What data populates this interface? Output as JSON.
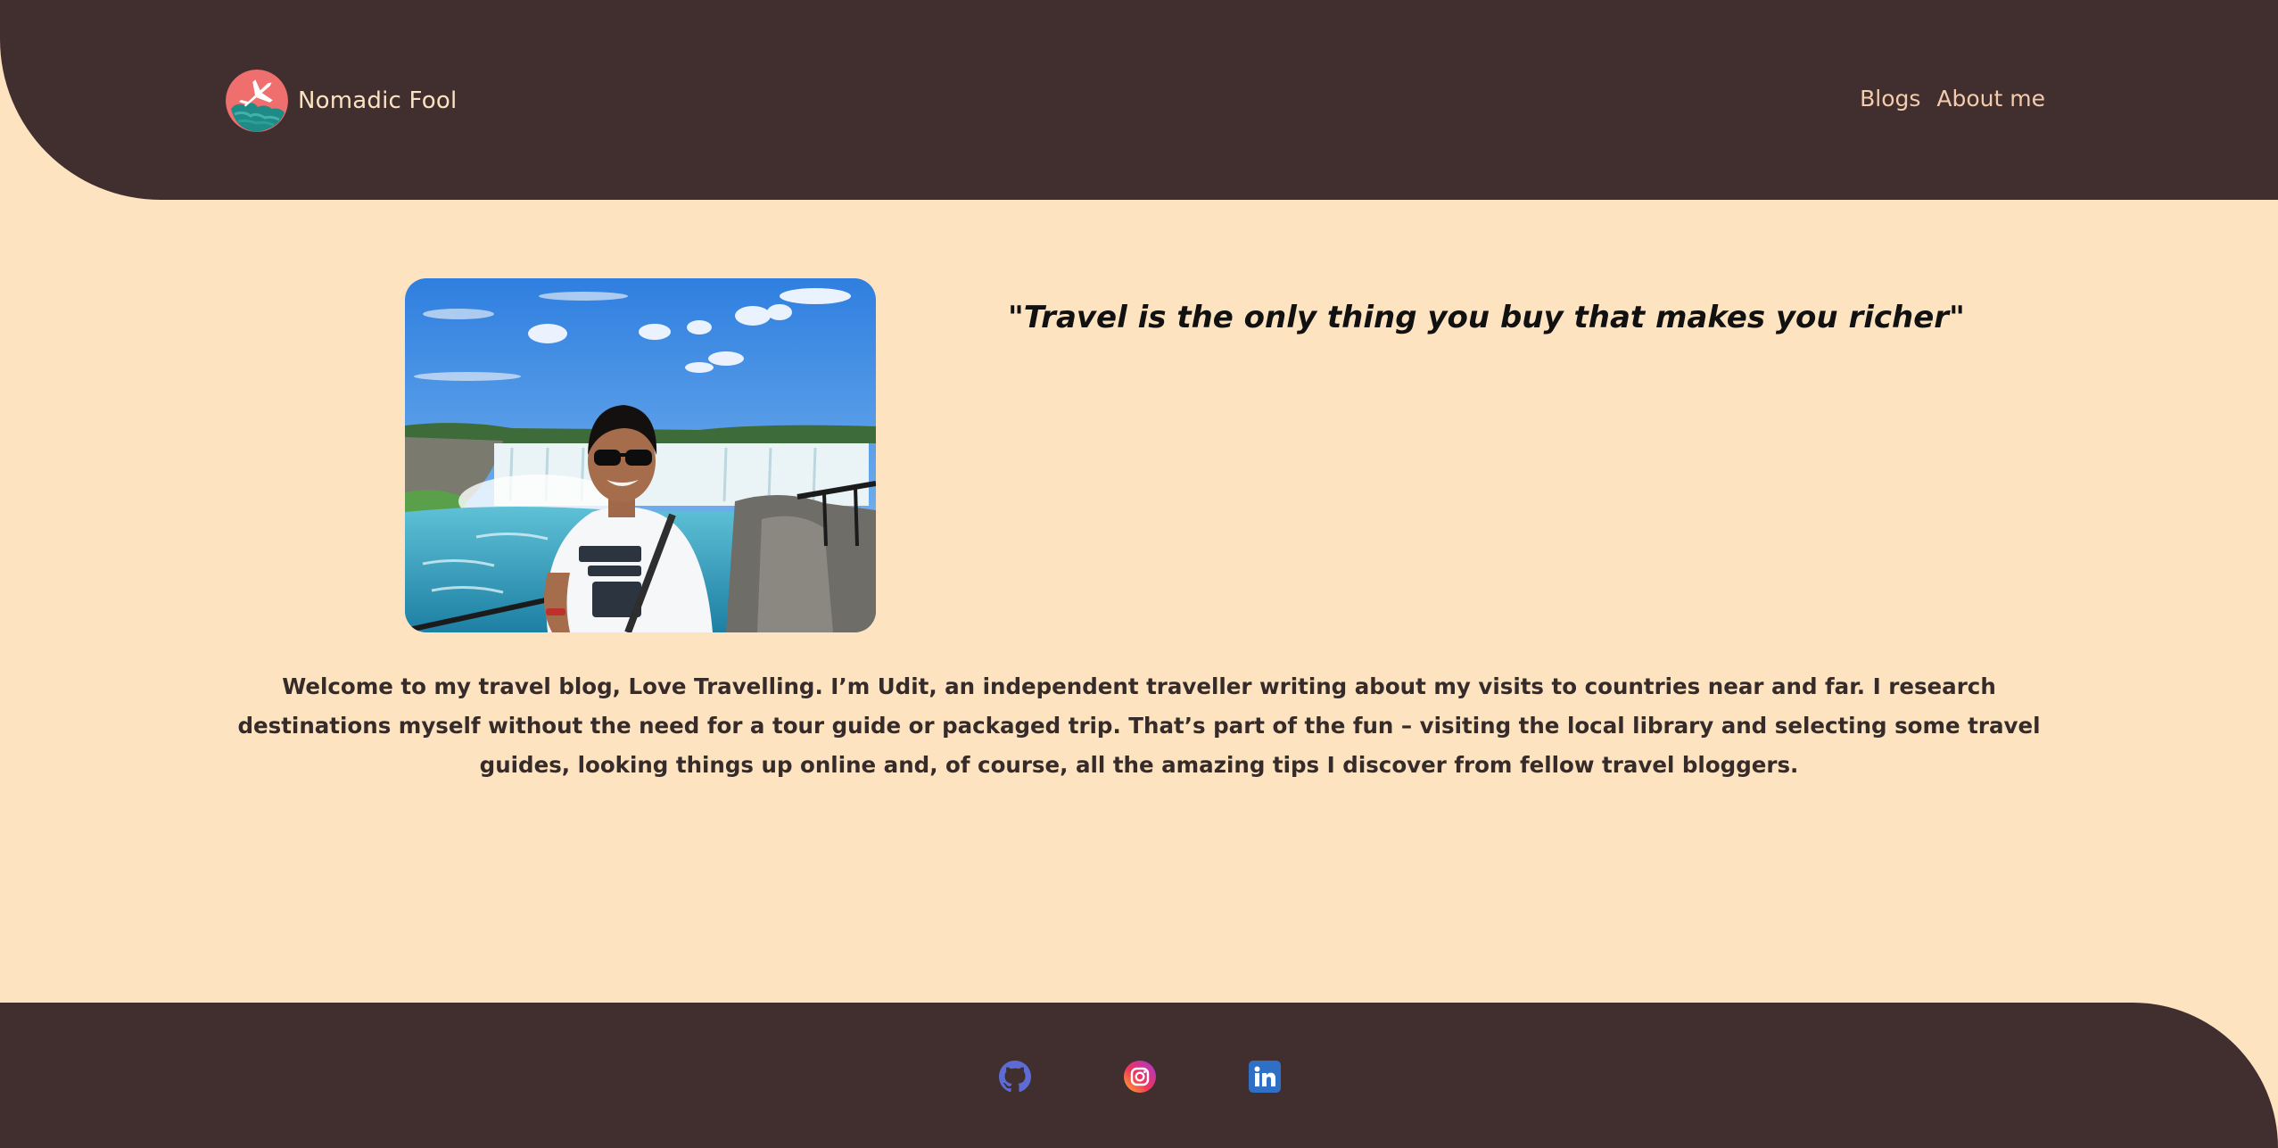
{
  "header": {
    "brand_name": "Nomadic Fool",
    "logo_icon": "airplane-globe-icon",
    "nav": [
      {
        "label": "Blogs"
      },
      {
        "label": "About me"
      }
    ]
  },
  "main": {
    "photo_alt": "Udit at Niagara Falls",
    "quote_open": "\"",
    "quote_text": "Travel is the only thing you buy that makes you richer",
    "quote_close": "\"",
    "intro_text": "Welcome to my travel blog, Love Travelling. I’m Udit, an independent traveller writing about my visits to countries near and far. I research destinations myself without the need for a tour guide or packaged trip. That’s part of the fun – visiting the local library and selecting some travel guides, looking things up online and, of course, all the amazing tips I discover from fellow travel bloggers."
  },
  "footer": {
    "social": [
      {
        "icon": "github-icon"
      },
      {
        "icon": "instagram-icon"
      },
      {
        "icon": "linkedin-icon"
      }
    ]
  },
  "colors": {
    "background": "#fde3c0",
    "header_footer": "#412e2f",
    "brand_text": "#fbe2c1",
    "nav_text": "#f4ccab",
    "body_text": "#352b2b"
  }
}
